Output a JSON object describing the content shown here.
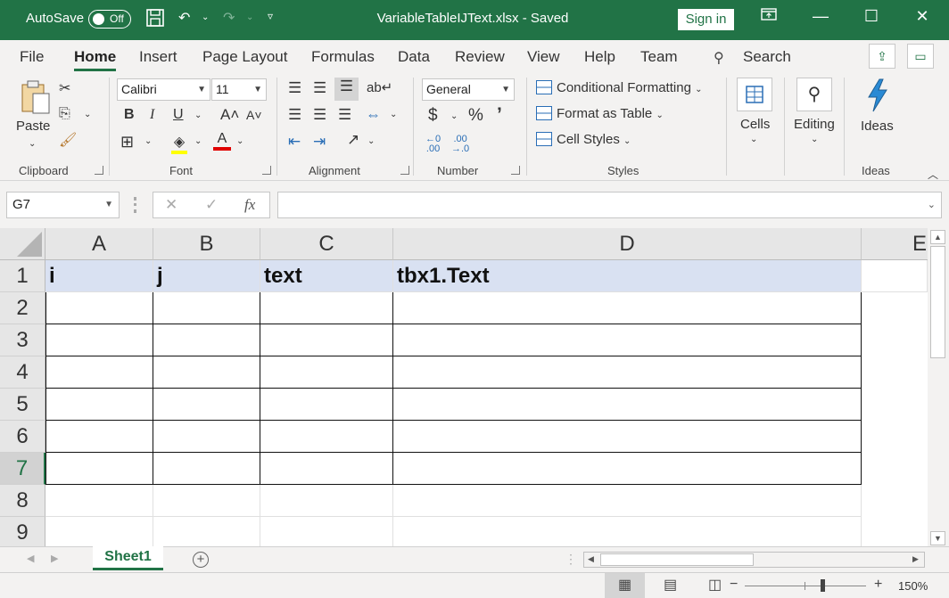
{
  "titlebar": {
    "autosave_label": "AutoSave",
    "autosave_state": "Off",
    "document_title": "VariableTableIJText.xlsx  -  Saved",
    "signin_label": "Sign in"
  },
  "menu": {
    "tabs": [
      "File",
      "Home",
      "Insert",
      "Page Layout",
      "Formulas",
      "Data",
      "Review",
      "View",
      "Help",
      "Team"
    ],
    "active_tab": "Home",
    "search_label": "Search"
  },
  "ribbon": {
    "clipboard": {
      "label": "Clipboard",
      "paste_label": "Paste"
    },
    "font": {
      "label": "Font",
      "font_name": "Calibri",
      "font_size": "11",
      "bold": "B",
      "italic": "I",
      "underline": "U"
    },
    "alignment": {
      "label": "Alignment"
    },
    "number": {
      "label": "Number",
      "format": "General",
      "currency": "$",
      "percent": "%",
      "comma": "’"
    },
    "styles": {
      "label": "Styles",
      "conditional_formatting": "Conditional Formatting",
      "format_as_table": "Format as Table",
      "cell_styles": "Cell Styles"
    },
    "cells": {
      "label": "Cells"
    },
    "editing": {
      "label": "Editing"
    },
    "ideas": {
      "label": "Ideas",
      "button_label": "Ideas"
    }
  },
  "formula_bar": {
    "name_box": "G7",
    "formula": ""
  },
  "grid": {
    "columns": [
      "A",
      "B",
      "C",
      "D",
      "E"
    ],
    "rows": [
      "1",
      "2",
      "3",
      "4",
      "5",
      "6",
      "7",
      "8",
      "9"
    ],
    "selected_row": "7",
    "header_row": [
      "i",
      "j",
      "text",
      "tbx1.Text"
    ]
  },
  "sheets": {
    "tabs": [
      "Sheet1"
    ],
    "active": "Sheet1"
  },
  "status": {
    "zoom": "150%"
  },
  "colors": {
    "accent": "#217346",
    "header_fill": "#d9e1f2",
    "font_color_bar": "#e00000"
  }
}
